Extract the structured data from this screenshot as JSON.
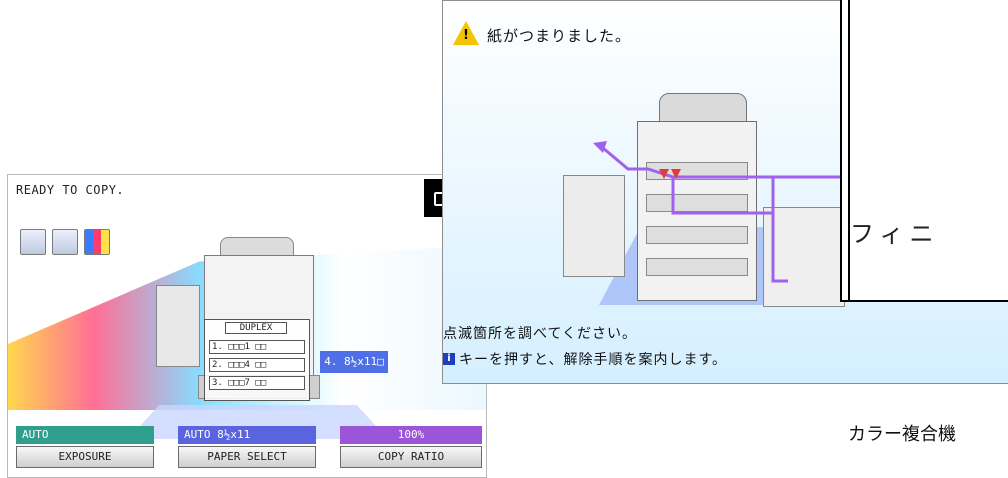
{
  "left_panel": {
    "status_text": "READY TO COPY.",
    "duplex": {
      "title": "DUPLEX",
      "rows": [
        "1. □□□1  □□",
        "2. □□□4  □□",
        "3. □□□7  □□"
      ]
    },
    "paper_size_chip": "4. 8½x11□",
    "buttons": [
      {
        "status": "AUTO",
        "label": "EXPOSURE",
        "color": "#2f9e8d"
      },
      {
        "status": "AUTO        8½x11",
        "label": "PAPER SELECT",
        "color": "#5a64df"
      },
      {
        "status": "100%",
        "label": "COPY RATIO",
        "color": "#9a55d8"
      }
    ]
  },
  "right_panel": {
    "title": "紙がつまりました。",
    "instruction_1": "点滅箇所を調べてください。",
    "instruction_2": "キーを押すと、解除手順を案内します。",
    "info_key_symbol": "i"
  },
  "overlap_window": {
    "text": "フィニ"
  },
  "caption": "カラー複合機"
}
